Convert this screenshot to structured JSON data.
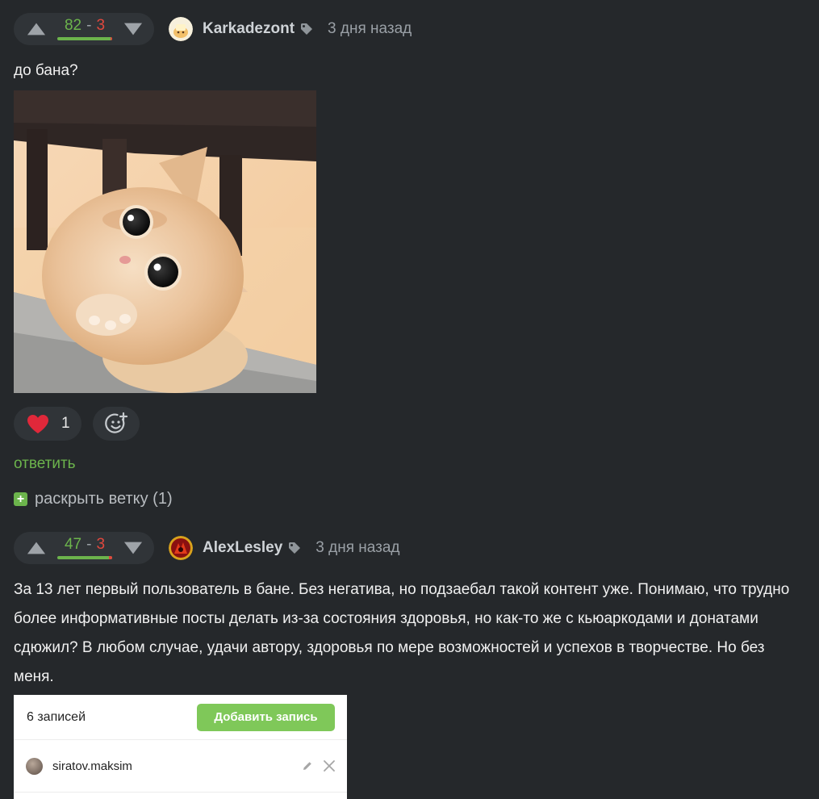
{
  "comments": [
    {
      "rating": {
        "plus": "82",
        "sep": "-",
        "minus": "3",
        "neg_fraction": 0.035
      },
      "author": "Karkadezont",
      "time": "3 дня назад",
      "text": "до бана?",
      "reactions": {
        "likes": "1"
      },
      "reply_label": "ответить",
      "expand_label": "раскрыть ветку (1)",
      "expand_icon": "+"
    },
    {
      "rating": {
        "plus": "47",
        "sep": "-",
        "minus": "3",
        "neg_fraction": 0.06
      },
      "author": "AlexLesley",
      "time": "3 дня назад",
      "text": "За 13 лет первый пользователь в бане. Без негатива, но подзаебал такой контент уже. Понимаю, что трудно более информативные посты делать из-за состояния здоровья, но как-то же с кьюаркодами и донатами сдюжил? В любом случае, удачи автору, здоровья по мере возможностей и успехов в творчестве. Но без меня."
    }
  ],
  "screenshot_panel": {
    "count_label": "6 записей",
    "add_button": "Добавить запись",
    "rows": [
      {
        "name": "siratov.maksim"
      }
    ]
  },
  "icons": {
    "upvote": "triangle-up-icon",
    "downvote": "triangle-down-icon",
    "tag": "tag-icon",
    "heart": "heart-icon",
    "emoji": "add-emoji-icon",
    "edit": "pencil-icon",
    "close": "close-icon"
  },
  "colors": {
    "background": "#25282b",
    "surface": "#303438",
    "accent_green": "#6cb44c",
    "negative_red": "#e0483e",
    "heart_red": "#e0283a"
  }
}
